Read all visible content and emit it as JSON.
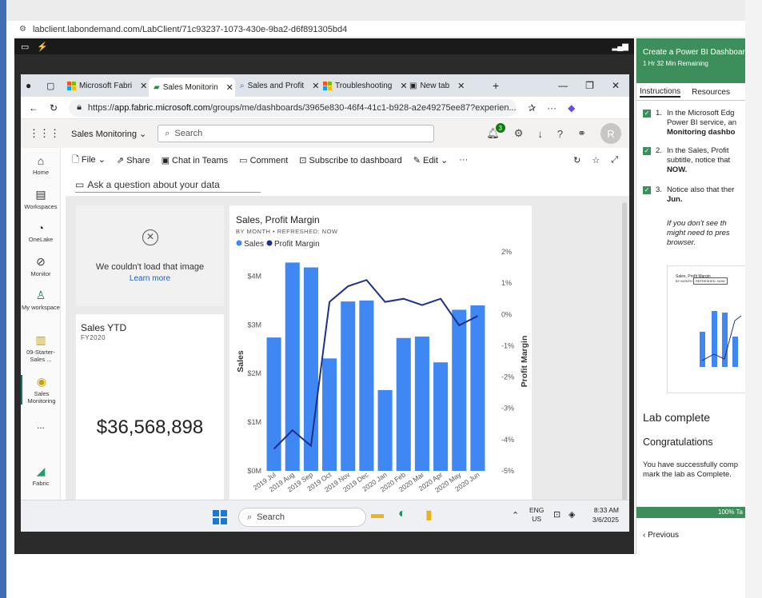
{
  "outer_url": "labclient.labondemand.com/LabClient/71c93237-1073-430e-9ba2-d6f891305bd4",
  "browser_tabs": [
    {
      "label": "Microsoft Fabri",
      "icon": "fabric-icon"
    },
    {
      "label": "Sales Monitorin",
      "icon": "powerbi-icon"
    },
    {
      "label": "Sales and Profit",
      "icon": "search-icon"
    },
    {
      "label": "Troubleshooting",
      "icon": "ms-logo-icon"
    },
    {
      "label": "New tab",
      "icon": "newtab-icon"
    }
  ],
  "address_bar": {
    "prefix": "https://",
    "host": "app.fabric.microsoft.com",
    "path": "/groups/me/dashboards/3965e830-46f4-41c1-b928-a2e49275ee87?experien..."
  },
  "pbi_header": {
    "workspace": "Sales Monitoring",
    "search_placeholder": "Search",
    "notification_count": "3",
    "avatar_initial": "R"
  },
  "left_nav": [
    {
      "label": "Home",
      "icon": "home-icon"
    },
    {
      "label": "Workspaces",
      "icon": "workspaces-icon"
    },
    {
      "label": "OneLake",
      "icon": "onelake-icon"
    },
    {
      "label": "Monitor",
      "icon": "monitor-icon"
    },
    {
      "label": "My workspace",
      "icon": "user-icon"
    },
    {
      "label": "09-Starter-Sales ...",
      "icon": "report-icon"
    },
    {
      "label": "Sales Monitoring",
      "icon": "dashboard-icon"
    },
    {
      "label": "...",
      "icon": "more-icon"
    },
    {
      "label": "Fabric",
      "icon": "fabric-icon"
    }
  ],
  "toolbar": {
    "file": "File",
    "share": "Share",
    "chat": "Chat in Teams",
    "comment": "Comment",
    "subscribe": "Subscribe to dashboard",
    "edit": "Edit",
    "more": "···"
  },
  "qa_prompt": "Ask a question about your data",
  "image_tile": {
    "message": "We couldn't load that image",
    "link": "Learn more"
  },
  "kpi_tile": {
    "title": "Sales YTD",
    "subtitle": "FY2020",
    "value": "$36,568,898"
  },
  "chart_data": {
    "type": "bar",
    "title": "Sales, Profit Margin",
    "subtitle": "BY MONTH  •  REFRESHED: NOW",
    "categories": [
      "2019 Jul",
      "2019 Aug",
      "2019 Sep",
      "2019 Oct",
      "2019 Nov",
      "2019 Dec",
      "2020 Jan",
      "2020 Feb",
      "2020 Mar",
      "2020 Apr",
      "2020 May",
      "2020 Jun"
    ],
    "series": [
      {
        "name": "Sales",
        "axis": "left",
        "kind": "bar",
        "color": "#3f87f2",
        "values": [
          2.74,
          4.28,
          4.18,
          2.31,
          3.48,
          3.5,
          1.66,
          2.73,
          2.76,
          2.23,
          3.31,
          3.4
        ]
      },
      {
        "name": "Profit Margin",
        "axis": "right",
        "kind": "line",
        "color": "#1f2f8e",
        "values": [
          -4.3,
          -3.7,
          -4.2,
          0.4,
          0.9,
          1.1,
          0.4,
          0.5,
          0.3,
          0.5,
          -0.35,
          -0.05
        ]
      }
    ],
    "ylabel": "Sales",
    "y2label": "Profit Margin",
    "ylim": [
      0,
      4.5
    ],
    "y2lim": [
      -5,
      2
    ],
    "yticks": [
      "$0M",
      "$1M",
      "$2M",
      "$3M",
      "$4M"
    ],
    "y2ticks": [
      "-5%",
      "-4%",
      "-3%",
      "-2%",
      "-1%",
      "0%",
      "1%",
      "2%"
    ],
    "legend": "top-left"
  },
  "taskbar": {
    "search": "Search",
    "lang1": "ENG",
    "lang2": "US",
    "time": "8:33 AM",
    "date": "3/6/2025"
  },
  "lab": {
    "title": "Create a Power BI Dashboar",
    "time_remaining": "1 Hr 32 Min Remaining",
    "tabs": [
      "Instructions",
      "Resources"
    ],
    "steps": [
      {
        "num": "1.",
        "lines": [
          "In the Microsoft Edg",
          "Power BI service, an",
          "Monitoring dashbo"
        ]
      },
      {
        "num": "2.",
        "lines": [
          "In the Sales, Profit",
          "subtitle, notice that",
          "NOW."
        ]
      },
      {
        "num": "3.",
        "lines": [
          "Notice also that ther",
          "Jun."
        ]
      }
    ],
    "note": [
      "If you don't see th",
      "might need to pres",
      "browser."
    ],
    "thumb_title": "Sales, Profit Margin",
    "thumb_sub": "BY MONTH",
    "thumb_refreshed": "REFRESHED: NOW",
    "complete_heading": "Lab complete",
    "congrats": "Congratulations",
    "done_text": [
      "You have successfully comp",
      "mark the lab as Complete."
    ],
    "progress": "100% Ta",
    "previous": "Previous"
  },
  "colors": {
    "accent_green": "#3c8f5a",
    "bar_blue": "#3f87f2",
    "line_navy": "#1f2f8e"
  }
}
